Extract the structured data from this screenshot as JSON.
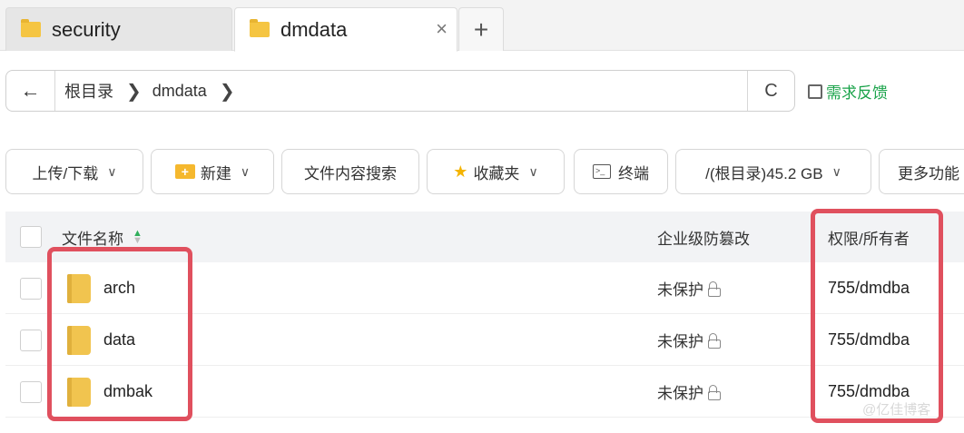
{
  "tabs": [
    {
      "label": "security",
      "active": false
    },
    {
      "label": "dmdata",
      "active": true
    }
  ],
  "tab_close": "×",
  "tab_add": "+",
  "address": {
    "back": "←",
    "crumbs": [
      "根目录",
      "dmdata"
    ],
    "sep": "❯",
    "refresh": "C"
  },
  "feedback": "需求反馈",
  "toolbar": {
    "upload_download": "上传/下载",
    "new": "新建",
    "content_search": "文件内容搜索",
    "favorites": "收藏夹",
    "terminal": "终端",
    "disk": "/(根目录)45.2 GB",
    "more": "更多功能",
    "chevron": "∨"
  },
  "table": {
    "headers": {
      "name": "文件名称",
      "protect": "企业级防篡改",
      "perm": "权限/所有者"
    },
    "rows": [
      {
        "name": "arch",
        "protect": "未保护",
        "perm": "755/dmdba"
      },
      {
        "name": "data",
        "protect": "未保护",
        "perm": "755/dmdba"
      },
      {
        "name": "dmbak",
        "protect": "未保护",
        "perm": "755/dmdba"
      }
    ]
  },
  "icons": [
    "folder-icon",
    "close-icon",
    "plus-icon",
    "back-arrow-icon",
    "chevron-right-icon",
    "refresh-icon",
    "feedback-icon",
    "new-folder-icon",
    "star-icon",
    "terminal-icon",
    "chevron-down-icon",
    "sort-icon",
    "lock-icon"
  ],
  "colors": {
    "accent_green": "#1aa34a",
    "highlight_red": "#e0505e",
    "folder": "#f1c44f"
  },
  "watermark": "@亿佳博客"
}
